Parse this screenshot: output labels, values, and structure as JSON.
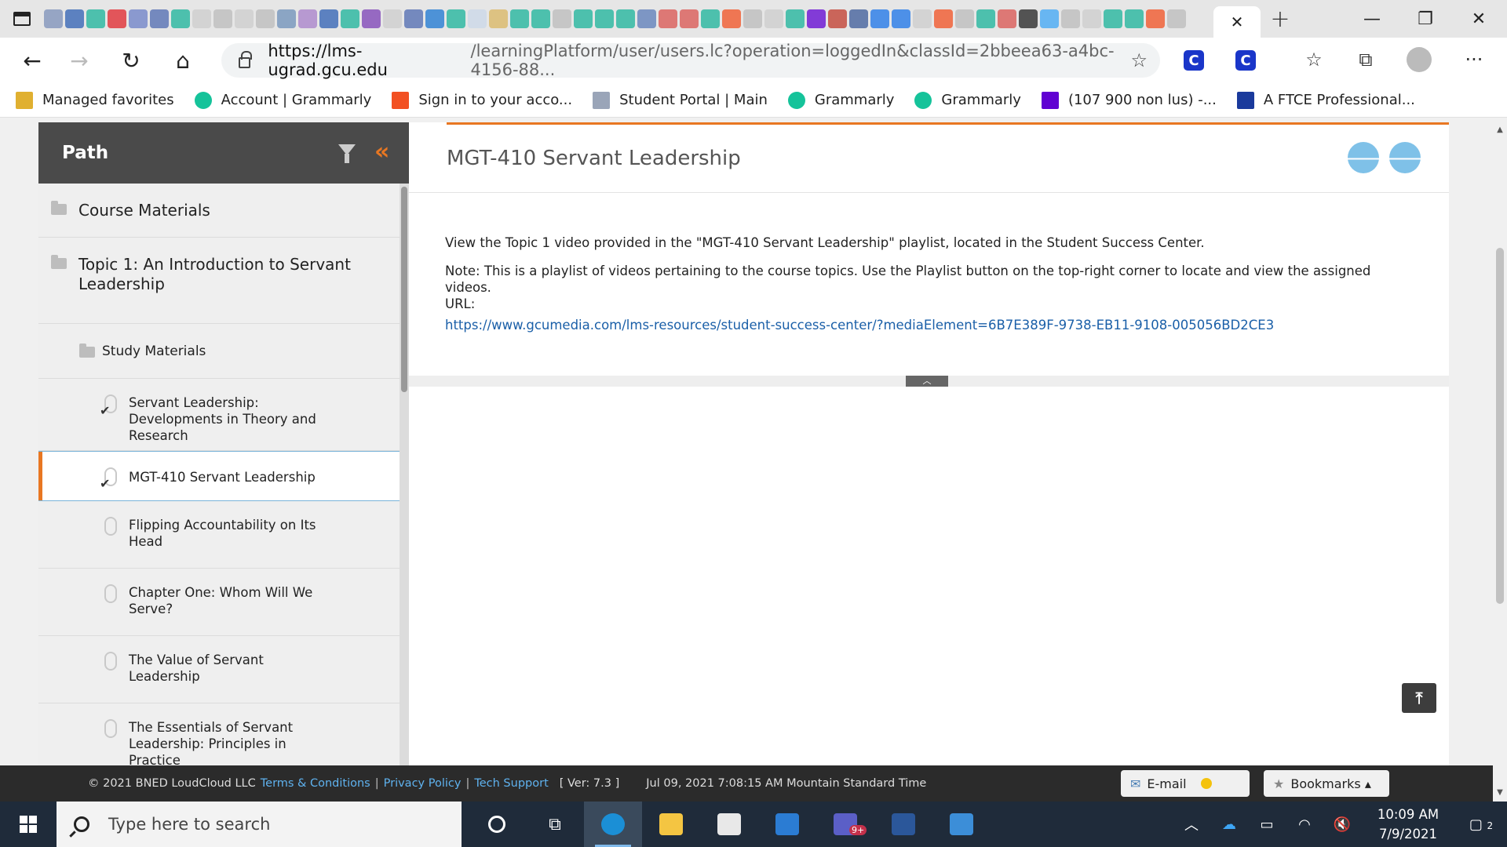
{
  "browser": {
    "active_tab_close": "✕",
    "new_tab": "+",
    "minimize": "—",
    "restore": "❐",
    "close": "✕",
    "url_host": "https://lms-ugrad.gcu.edu",
    "url_path": "/learningPlatform/user/users.lc?operation=loggedIn&classId=2bbeea63-a4bc-4156-88...",
    "ext1": "C",
    "ext2": "C",
    "more": "···",
    "favorites": [
      {
        "label": "Managed favorites",
        "icon": "folder-icon",
        "color": "#e0b030"
      },
      {
        "label": "Account | Grammarly",
        "icon": "grammarly-icon",
        "color": "#15c39a"
      },
      {
        "label": "Sign in to your acco...",
        "icon": "microsoft-icon",
        "color": "#f25022"
      },
      {
        "label": "Student Portal | Main",
        "icon": "page-icon",
        "color": "#9aa5b8"
      },
      {
        "label": "Grammarly",
        "icon": "grammarly-icon",
        "color": "#15c39a"
      },
      {
        "label": "Grammarly",
        "icon": "grammarly-icon",
        "color": "#15c39a"
      },
      {
        "label": "(107 900 non lus) -...",
        "icon": "mail-icon",
        "color": "#6001d2"
      },
      {
        "label": "A FTCE Professional...",
        "icon": "p-icon",
        "color": "#1a3a9c"
      }
    ]
  },
  "sidebar": {
    "title": "Path",
    "items": [
      {
        "label": "Course Materials",
        "level": 0
      },
      {
        "label": "Topic 1: An Introduction to Servant Leadership",
        "level": 0
      },
      {
        "label": "Study Materials",
        "level": 1
      },
      {
        "label": "Servant Leadership: Developments in Theory and Research",
        "level": 2,
        "done": true
      },
      {
        "label": "MGT-410 Servant Leadership",
        "level": 2,
        "done": true,
        "active": true
      },
      {
        "label": "Flipping Accountability on Its Head",
        "level": 2
      },
      {
        "label": "Chapter One: Whom Will We Serve?",
        "level": 2
      },
      {
        "label": "The Value of Servant Leadership",
        "level": 2
      },
      {
        "label": "The Essentials of Servant Leadership: Principles in Practice",
        "level": 2
      }
    ]
  },
  "main": {
    "title": "MGT-410 Servant Leadership",
    "prev_icon": "🡐",
    "next_icon": "🡒",
    "paragraph1": "View the Topic 1 video provided in the \"MGT-410 Servant Leadership\" playlist, located in the Student Success Center.",
    "paragraph2": "Note: This is a playlist of videos pertaining to the course topics. Use the Playlist button on the top-right corner to locate and view the assigned videos.",
    "url_label": "URL:",
    "link": "https://www.gcumedia.com/lms-resources/student-success-center/?mediaElement=6B7E389F-9738-EB11-9108-005056BD2CE3",
    "collapse_tab": "︿",
    "to_top": "⤒"
  },
  "footer": {
    "copyright": "© 2021 BNED LoudCloud LLC",
    "terms": "Terms & Conditions",
    "privacy": "Privacy Policy",
    "support": "Tech Support",
    "version": "[ Ver: 7.3 ]",
    "datetime": "Jul 09, 2021  7:08:15 AM Mountain Standard Time",
    "email_label": "E-mail",
    "bookmarks_label": "Bookmarks ▴",
    "sep": "|"
  },
  "taskbar": {
    "search_placeholder": "Type here to search",
    "time": "10:09 AM",
    "date": "7/9/2021",
    "teams_badge": "9+",
    "notif_count": "2"
  }
}
